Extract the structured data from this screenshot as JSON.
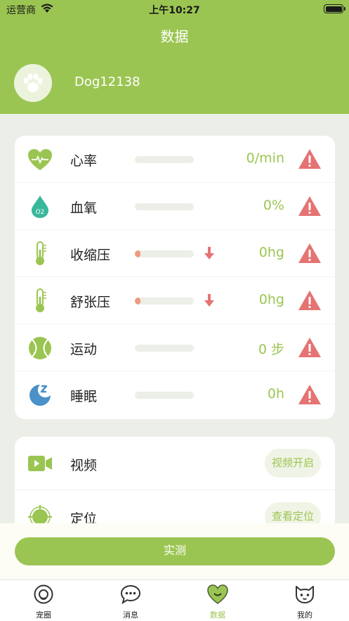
{
  "status_bar": {
    "carrier": "运营商",
    "time": "上午10:27"
  },
  "header": {
    "title": "数据",
    "pet_name": "Dog12138"
  },
  "metrics": [
    {
      "label": "心率",
      "value": "0/min",
      "icon": "heart-rate-icon",
      "level": 0
    },
    {
      "label": "血氧",
      "value": "0%",
      "icon": "blood-oxygen-icon",
      "level": 0
    },
    {
      "label": "收缩压",
      "value": "0hg",
      "icon": "thermometer-icon",
      "level": 0.1,
      "trend": "down"
    },
    {
      "label": "舒张压",
      "value": "0hg",
      "icon": "thermometer-icon",
      "level": 0.1,
      "trend": "down"
    },
    {
      "label": "运动",
      "value": "0 步",
      "icon": "tennis-ball-icon",
      "level": 0
    },
    {
      "label": "睡眠",
      "value": "0h",
      "icon": "sleep-moon-icon",
      "level": 0
    }
  ],
  "features": [
    {
      "label": "视频",
      "button": "视频开启",
      "icon": "video-camera-icon"
    },
    {
      "label": "定位",
      "button": "查看定位",
      "icon": "location-target-icon"
    }
  ],
  "actions": {
    "measure": "实测"
  },
  "tabbar": {
    "items": [
      {
        "label": "宠圈",
        "icon": "pet-circle-icon"
      },
      {
        "label": "消息",
        "icon": "chat-bubble-icon"
      },
      {
        "label": "数据",
        "icon": "heart-face-icon",
        "active": true
      },
      {
        "label": "我的",
        "icon": "cat-face-icon"
      }
    ]
  },
  "colors": {
    "brand_green": "#9bc552",
    "warning_red": "#e57373",
    "bar_fill": "#ef9a80",
    "sleep_blue": "#4a90c9",
    "oxygen_teal": "#38b79a"
  }
}
